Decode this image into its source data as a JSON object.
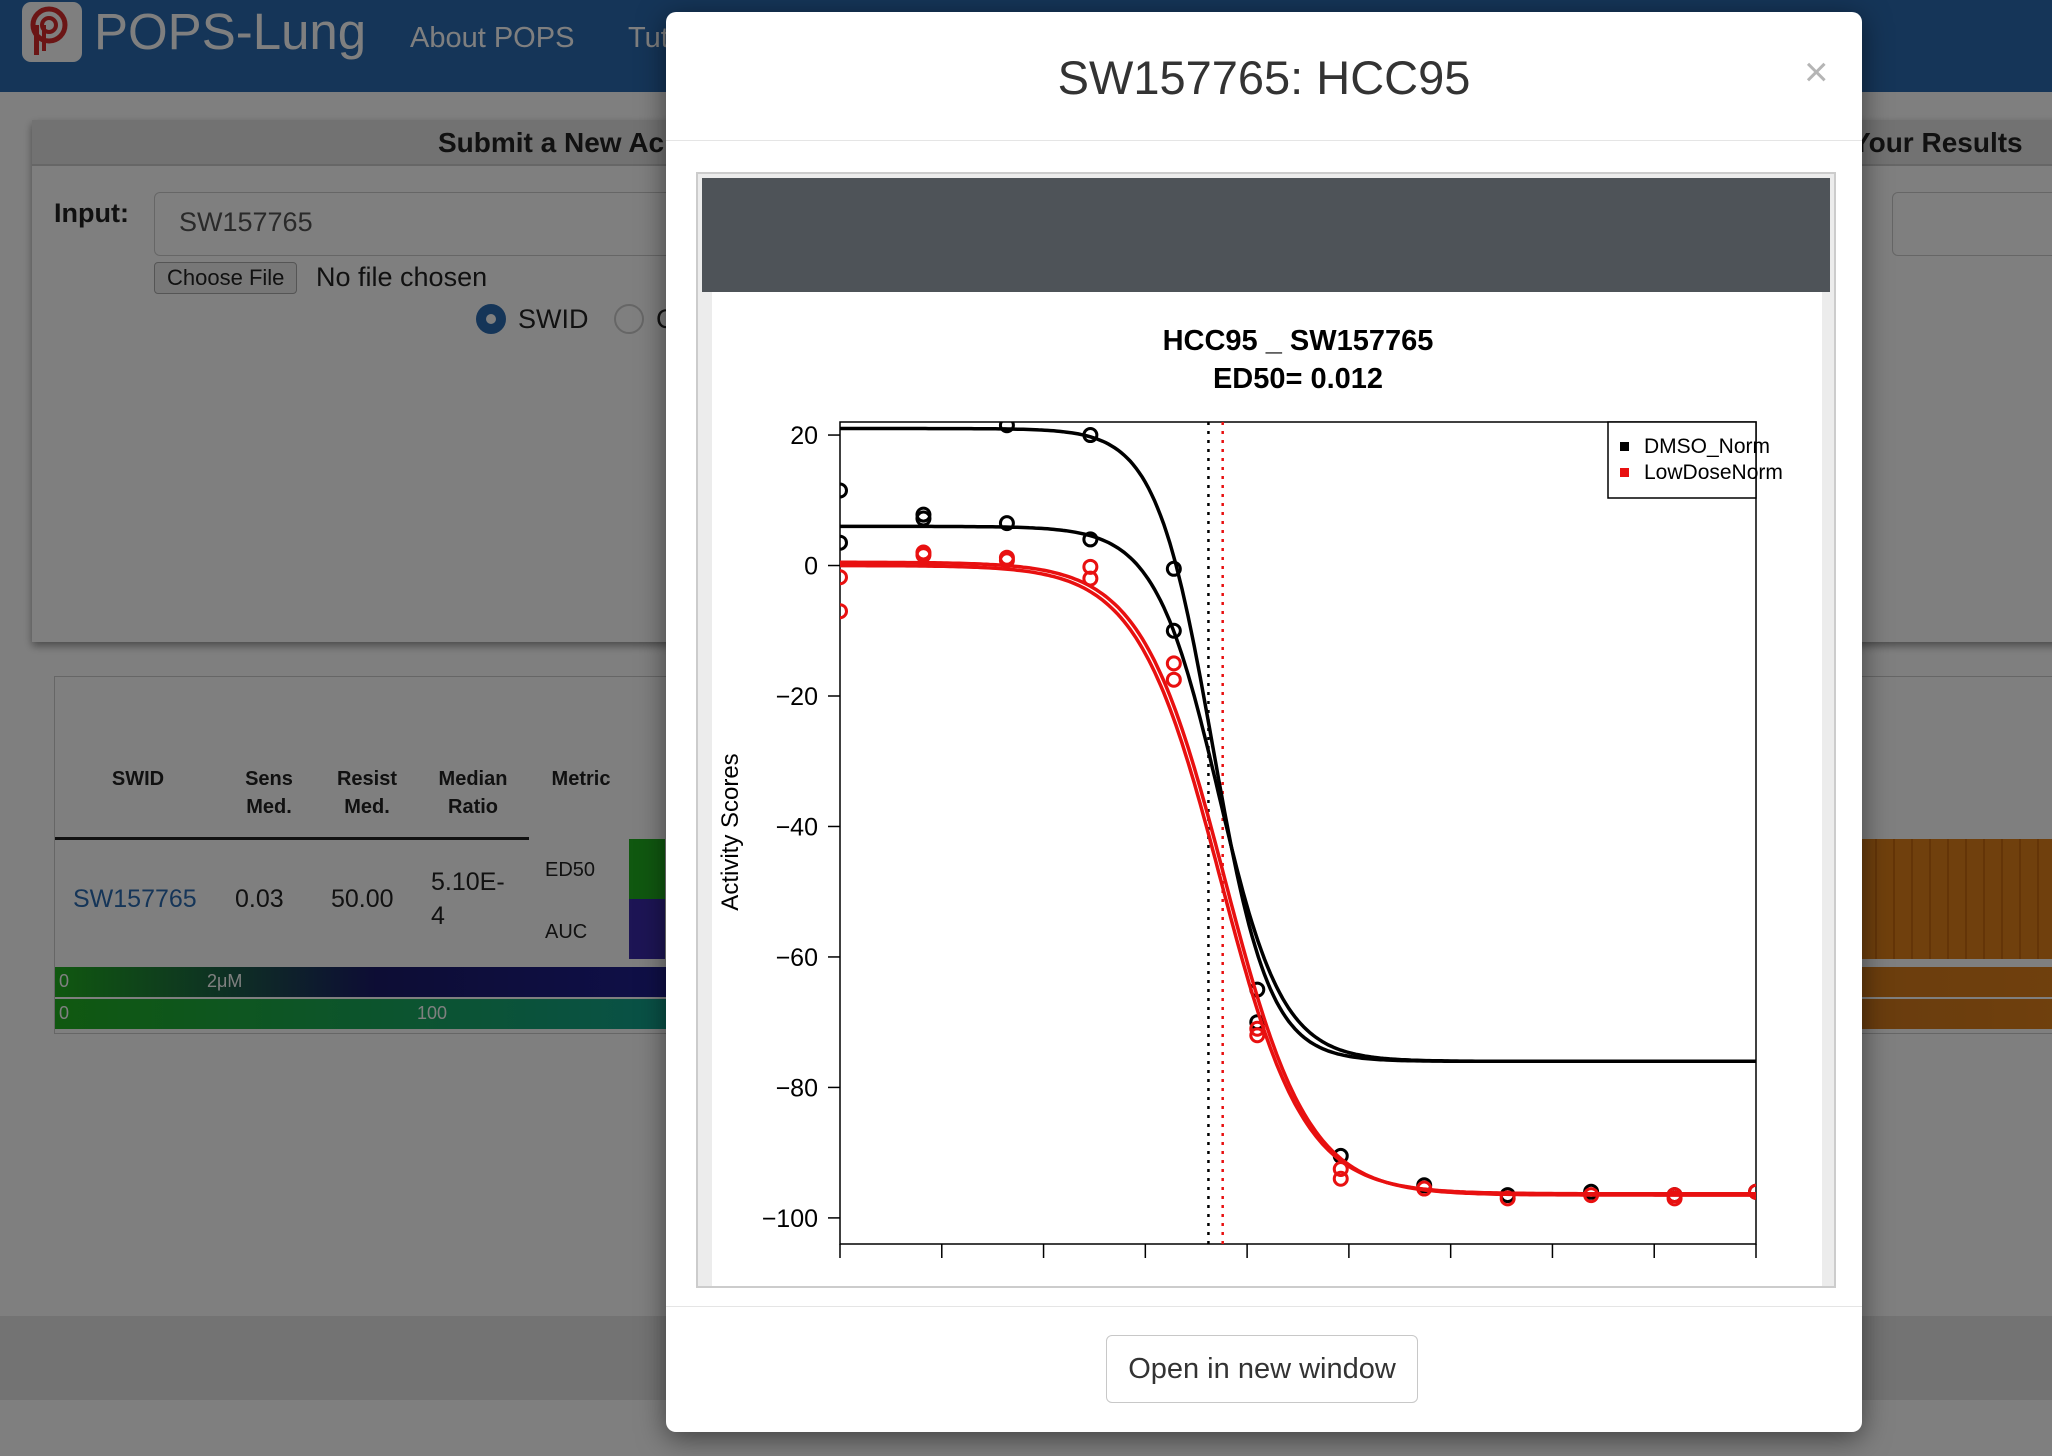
{
  "nav": {
    "brand": "POPS-Lung",
    "links": [
      "About POPS",
      "Tut"
    ]
  },
  "submit_card": {
    "header_left": "Submit a New Ac",
    "header_right": "Your Results",
    "input_label": "Input:",
    "input_value": "SW157765",
    "choose_file": "Choose File",
    "no_file": "No file chosen",
    "radio_swid": "SWID",
    "radio_other": "C"
  },
  "results_table": {
    "headers": [
      "SWID",
      "Sens\nMed.",
      "Resist\nMed.",
      "Median\nRatio",
      "Metric"
    ],
    "row": {
      "swid": "SW157765",
      "sens_med": "0.03",
      "resist_med": "50.00",
      "median_ratio": "5.10E-\n4",
      "metrics": [
        "ED50",
        "AUC"
      ]
    },
    "legend_ed50": {
      "left": "0",
      "center": "2μM"
    },
    "legend_auc": {
      "left": "0",
      "center": "100"
    }
  },
  "modal": {
    "title": "SW157765: HCC95",
    "close": "×",
    "open_button": "Open in new window"
  },
  "chart_data": {
    "type": "scatter",
    "title": "HCC95 _ SW157765",
    "subtitle": "ED50= 0.012",
    "xlabel": "",
    "ylabel": "Activity Scores",
    "ylim": [
      -104,
      22
    ],
    "xlim": [
      0,
      9
    ],
    "x_ticks": [
      0,
      1,
      2,
      3,
      4,
      5,
      6,
      7,
      8,
      9
    ],
    "y_ticks": [
      20,
      0,
      -20,
      -40,
      -60,
      -80,
      -100
    ],
    "y_tick_labels": [
      "20",
      "0",
      "−20",
      "−40",
      "−60",
      "−80",
      "−100"
    ],
    "legend_position": "top-right",
    "ed50_lines": [
      {
        "series": "DMSO_Norm",
        "x": 3.62,
        "color": "#000000"
      },
      {
        "series": "LowDoseNorm",
        "x": 3.76,
        "color": "#e81010"
      }
    ],
    "series": [
      {
        "name": "DMSO_Norm",
        "color": "#000000",
        "points": [
          [
            0,
            11.5
          ],
          [
            0,
            3.5
          ],
          [
            0.82,
            7.8
          ],
          [
            0.82,
            7.2
          ],
          [
            1.64,
            21.5
          ],
          [
            1.64,
            6.5
          ],
          [
            2.46,
            20
          ],
          [
            2.46,
            4
          ],
          [
            3.28,
            -0.5
          ],
          [
            3.28,
            -10
          ],
          [
            4.1,
            -65
          ],
          [
            4.1,
            -70
          ],
          [
            4.92,
            -90.5
          ],
          [
            5.74,
            -95
          ],
          [
            6.56,
            -96.5
          ],
          [
            7.38,
            -96
          ],
          [
            8.2,
            -96.5
          ],
          [
            9,
            -96
          ]
        ],
        "curves": [
          {
            "top": 21,
            "bottom": -76,
            "mid": 3.66,
            "k": 3.6
          },
          {
            "top": 6,
            "bottom": -76,
            "mid": 3.72,
            "k": 3.2
          }
        ]
      },
      {
        "name": "LowDoseNorm",
        "color": "#e81010",
        "points": [
          [
            0,
            -1.8
          ],
          [
            0,
            -7
          ],
          [
            0.82,
            2
          ],
          [
            0.82,
            1.6
          ],
          [
            1.64,
            1.2
          ],
          [
            1.64,
            0.8
          ],
          [
            2.46,
            -0.2
          ],
          [
            2.46,
            -2
          ],
          [
            3.28,
            -15
          ],
          [
            3.28,
            -17.5
          ],
          [
            4.1,
            -71
          ],
          [
            4.1,
            -72
          ],
          [
            4.92,
            -92.5
          ],
          [
            4.92,
            -94
          ],
          [
            5.74,
            -95.5
          ],
          [
            6.56,
            -97
          ],
          [
            7.38,
            -96.5
          ],
          [
            8.2,
            -96.5
          ],
          [
            8.2,
            -97
          ],
          [
            9,
            -96
          ]
        ],
        "curves": [
          {
            "top": 0.5,
            "bottom": -96.5,
            "mid": 3.78,
            "k": 2.45
          },
          {
            "top": 0,
            "bottom": -96.3,
            "mid": 3.74,
            "k": 2.45
          }
        ]
      }
    ]
  }
}
